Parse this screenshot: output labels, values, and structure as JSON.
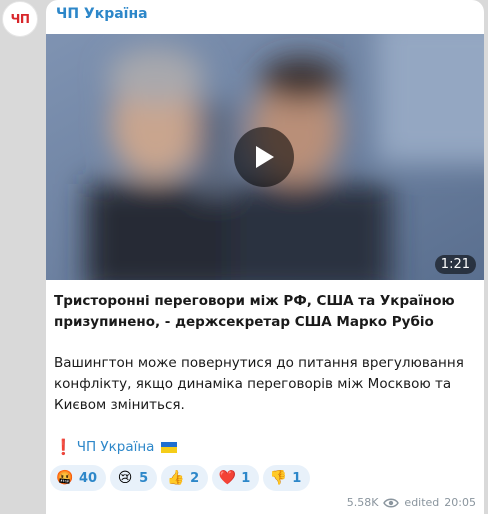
{
  "channel": {
    "name": "ЧП Україна",
    "avatar_text": "ЧП"
  },
  "video": {
    "duration": "1:21",
    "play_icon": "play-icon"
  },
  "post": {
    "headline": "Тристоронні переговори між РФ, США та Україною призупинено, - держсекретар США Марко Рубіо",
    "body": "Вашингтон може повернутися до питання врегулювання конфлікту, якщо динаміка переговорів між Москвою та Києвом зміниться.",
    "signature_mark": "❗",
    "signature": "ЧП Україна"
  },
  "reactions": [
    {
      "emoji": "🤬",
      "count": "40"
    },
    {
      "emoji": "😢",
      "count": "5"
    },
    {
      "emoji": "👍",
      "count": "2"
    },
    {
      "emoji": "❤️",
      "count": "1"
    },
    {
      "emoji": "👎",
      "count": "1"
    }
  ],
  "meta": {
    "views": "5.58K",
    "edited": "edited",
    "time": "20:05"
  },
  "colors": {
    "accent": "#2d87c9",
    "background": "#d9d9d9",
    "avatar_red": "#d8262a"
  }
}
